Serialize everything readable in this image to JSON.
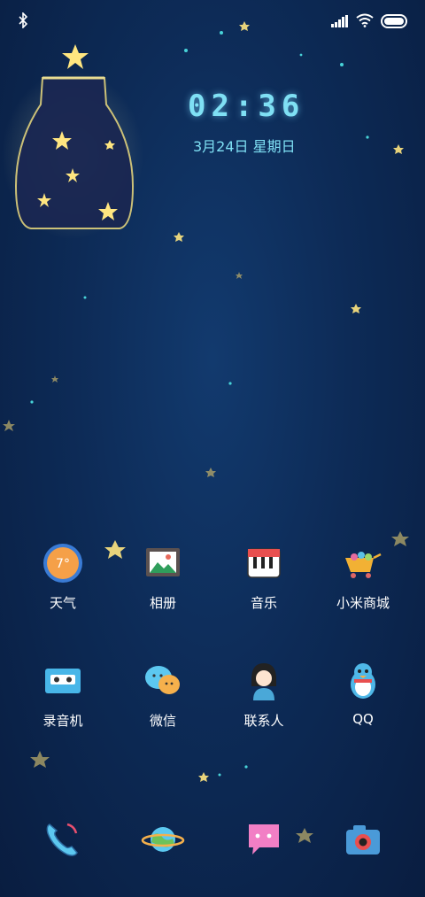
{
  "status_bar": {
    "icons": [
      "bluetooth-icon",
      "signal-icon",
      "wifi-icon",
      "battery-icon"
    ]
  },
  "clock": {
    "time": "02:36",
    "date": "3月24日 星期日"
  },
  "apps_row1": [
    {
      "label": "天气",
      "weather_temp": "7°",
      "icon": "weather-icon"
    },
    {
      "label": "相册",
      "icon": "gallery-icon"
    },
    {
      "label": "音乐",
      "icon": "music-icon"
    },
    {
      "label": "小米商城",
      "icon": "mall-icon"
    }
  ],
  "apps_row2": [
    {
      "label": "录音机",
      "icon": "recorder-icon"
    },
    {
      "label": "微信",
      "icon": "wechat-icon"
    },
    {
      "label": "联系人",
      "icon": "contacts-icon"
    },
    {
      "label": "QQ",
      "icon": "qq-icon"
    }
  ],
  "dock": [
    "phone-icon",
    "browser-icon",
    "messages-icon",
    "camera-icon"
  ],
  "colors": {
    "accent": "#7fe0f4",
    "background": "#0d2b57"
  }
}
